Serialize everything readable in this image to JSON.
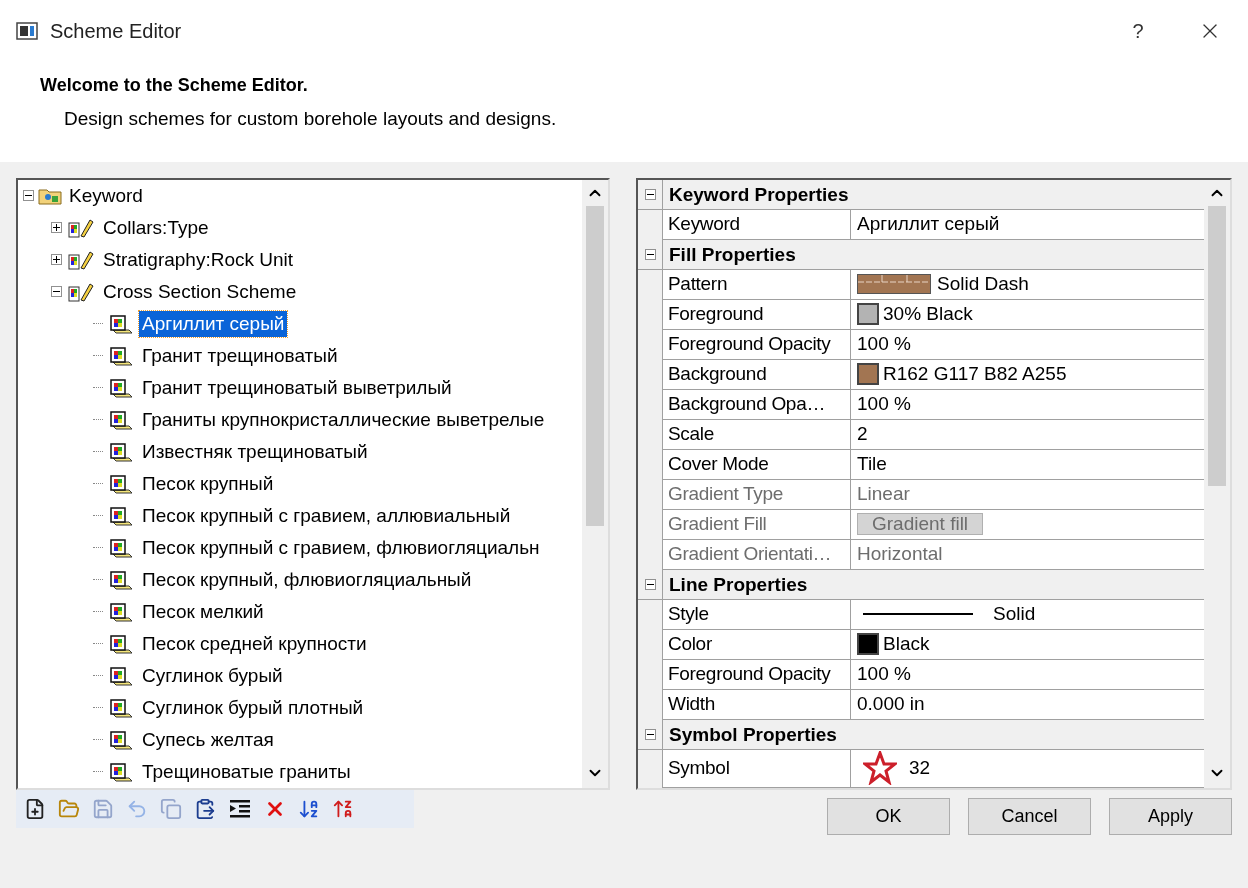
{
  "window": {
    "title": "Scheme Editor",
    "help": "?"
  },
  "header": {
    "title": "Welcome to the Scheme Editor.",
    "subtitle": "Design schemes for custom borehole layouts and designs."
  },
  "tree": {
    "label": "Keyword",
    "expanded": true,
    "children": [
      {
        "label": "Collars:Type",
        "expanded": false
      },
      {
        "label": "Stratigraphy:Rock Unit",
        "expanded": false
      },
      {
        "label": "Cross Section Scheme",
        "expanded": true,
        "children": [
          {
            "label": "Аргиллит серый",
            "selected": true
          },
          {
            "label": "Гранит трещиноватый",
            "selected": false
          },
          {
            "label": "Гранит трещиноватый выветрилый",
            "selected": false
          },
          {
            "label": "Граниты крупнокристаллические выветрелые",
            "selected": false
          },
          {
            "label": "Известняк трещиноватый",
            "selected": false
          },
          {
            "label": "Песок крупный",
            "selected": false
          },
          {
            "label": "Песок крупный с гравием, аллювиальный",
            "selected": false
          },
          {
            "label": "Песок крупный с гравием, флювиогляциальн",
            "selected": false
          },
          {
            "label": "Песок крупный, флювиогляциальный",
            "selected": false
          },
          {
            "label": "Песок мелкий",
            "selected": false
          },
          {
            "label": "Песок средней крупности",
            "selected": false
          },
          {
            "label": "Суглинок бурый",
            "selected": false
          },
          {
            "label": "Суглинок бурый плотный",
            "selected": false
          },
          {
            "label": "Супесь желтая",
            "selected": false
          },
          {
            "label": "Трещиноватые граниты",
            "selected": false
          }
        ]
      }
    ]
  },
  "toolbar": [
    {
      "kind": "new",
      "disabled": false
    },
    {
      "kind": "open",
      "disabled": false
    },
    {
      "kind": "save",
      "disabled": true
    },
    {
      "kind": "undo",
      "disabled": true
    },
    {
      "kind": "copy",
      "disabled": true
    },
    {
      "kind": "paste",
      "disabled": false
    },
    {
      "kind": "indent",
      "disabled": false
    },
    {
      "kind": "delete",
      "disabled": false
    },
    {
      "kind": "sort-asc",
      "disabled": false
    },
    {
      "kind": "sort-desc",
      "disabled": false
    }
  ],
  "properties": [
    {
      "category": "Keyword Properties",
      "expanded": true,
      "rows": [
        {
          "name": "Keyword",
          "value": "Аргиллит  серый",
          "kind": "text",
          "disabled": false
        }
      ]
    },
    {
      "category": "Fill Properties",
      "expanded": true,
      "rows": [
        {
          "name": "Pattern",
          "value": "Solid Dash",
          "kind": "pattern",
          "color": "#a27552",
          "disabled": false
        },
        {
          "name": "Foreground",
          "value": "30% Black",
          "kind": "swatch",
          "color": "#b3b3b3",
          "disabled": false
        },
        {
          "name": "Foreground Opacity",
          "value": "100 %",
          "kind": "text",
          "disabled": false
        },
        {
          "name": "Background",
          "value": "R162 G117 B82 A255",
          "kind": "swatch",
          "color": "#a27552",
          "disabled": false
        },
        {
          "name": "Background Opa…",
          "value": "100 %",
          "kind": "text",
          "disabled": false
        },
        {
          "name": "Scale",
          "value": "2",
          "kind": "text",
          "disabled": false
        },
        {
          "name": "Cover Mode",
          "value": "Tile",
          "kind": "text",
          "disabled": false
        },
        {
          "name": "Gradient Type",
          "value": "Linear",
          "kind": "text",
          "disabled": true
        },
        {
          "name": "Gradient Fill",
          "value": "Gradient fill",
          "kind": "button",
          "disabled": true
        },
        {
          "name": "Gradient Orientati…",
          "value": "Horizontal",
          "kind": "text",
          "disabled": true
        }
      ]
    },
    {
      "category": "Line Properties",
      "expanded": true,
      "rows": [
        {
          "name": "Style",
          "value": "Solid",
          "kind": "line",
          "disabled": false
        },
        {
          "name": "Color",
          "value": "Black",
          "kind": "swatch",
          "color": "#000000",
          "disabled": false
        },
        {
          "name": "Foreground Opacity",
          "value": "100 %",
          "kind": "text",
          "disabled": false
        },
        {
          "name": "Width",
          "value": "0.000 in",
          "kind": "text",
          "disabled": false
        }
      ]
    },
    {
      "category": "Symbol Properties",
      "expanded": true,
      "rows": [
        {
          "name": "Symbol",
          "value": "32",
          "kind": "symbol",
          "color": "#cc1f2a",
          "disabled": false
        }
      ]
    }
  ],
  "buttons": [
    "OK",
    "Cancel",
    "Apply"
  ]
}
